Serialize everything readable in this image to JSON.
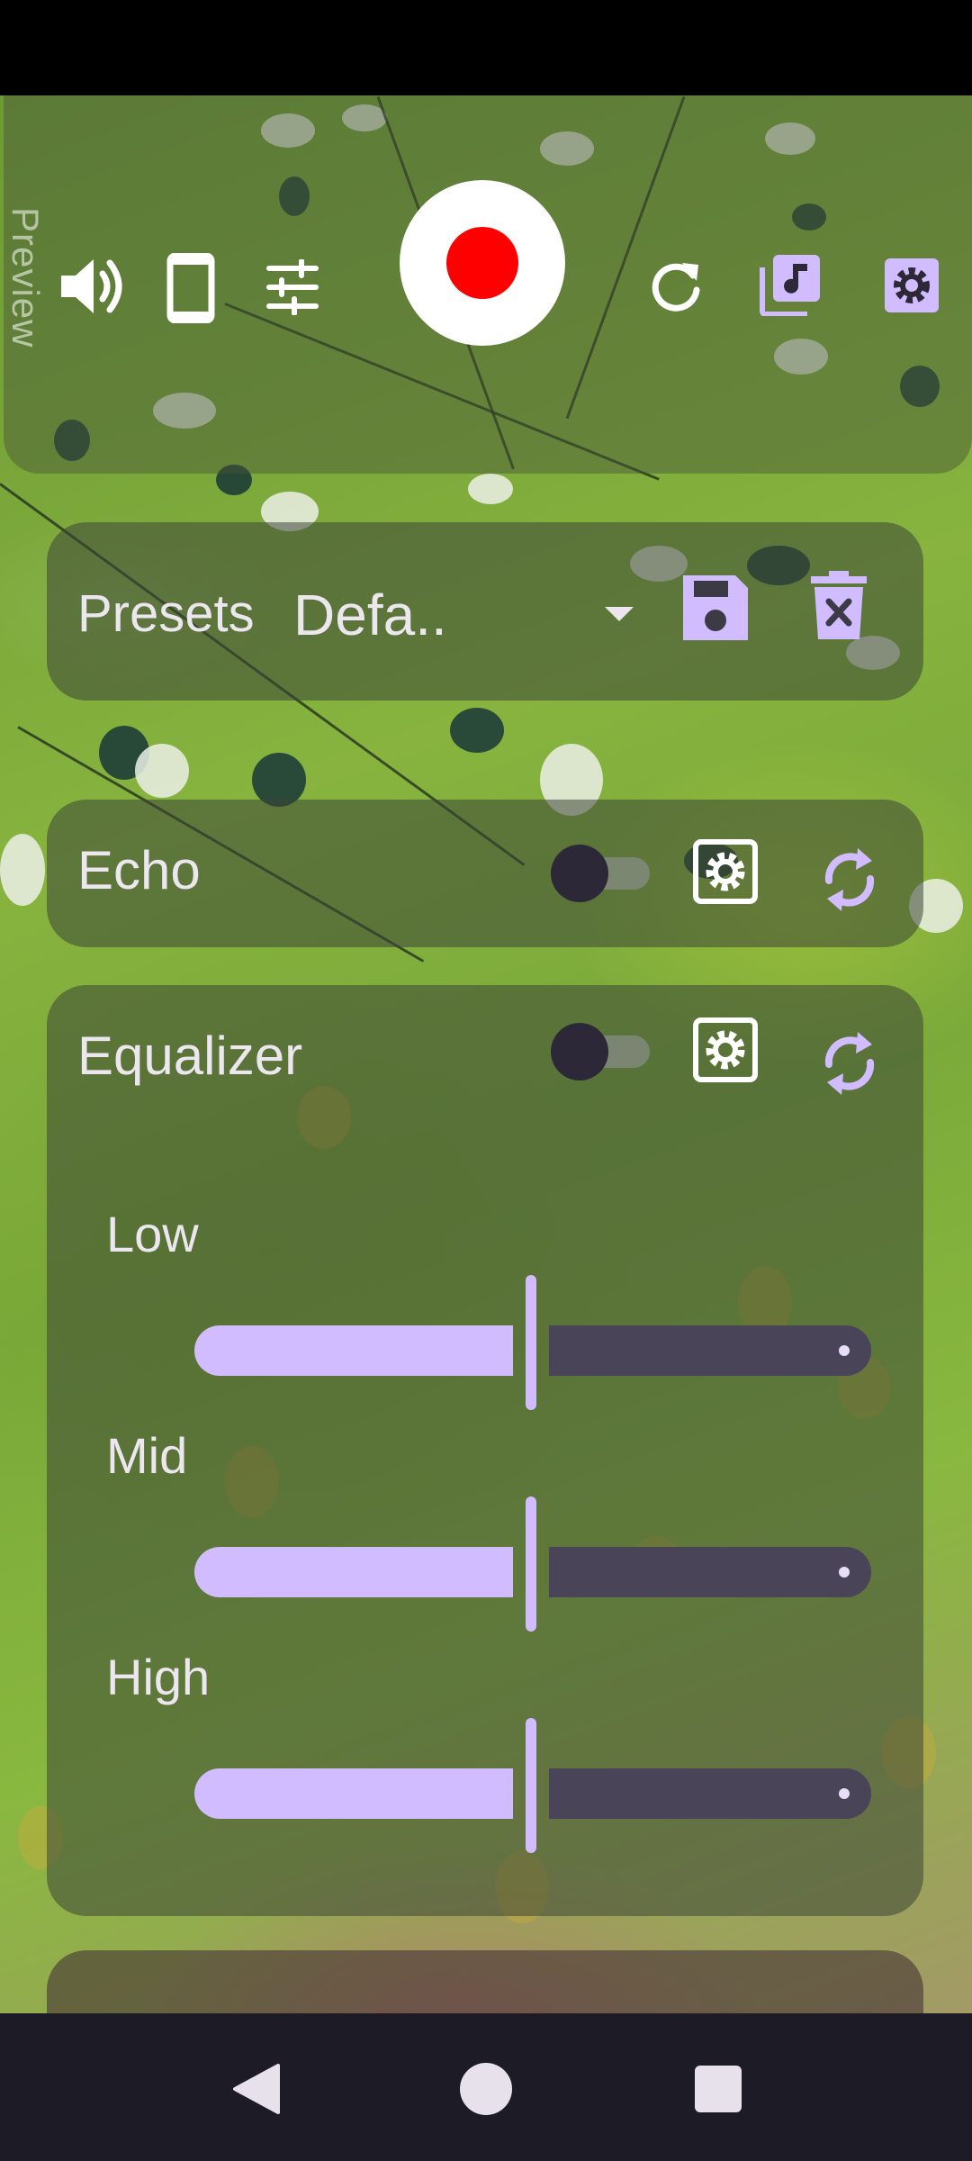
{
  "top_panel": {
    "preview_label": "Preview",
    "icons": [
      "speaker-icon",
      "phone-icon",
      "sliders-icon",
      "record-icon",
      "refresh-icon",
      "music-library-icon",
      "settings-icon"
    ]
  },
  "presets": {
    "label": "Presets",
    "selected": "Defa.."
  },
  "echo": {
    "title": "Echo",
    "enabled": false
  },
  "equalizer": {
    "title": "Equalizer",
    "enabled": false,
    "bands": [
      {
        "label": "Low",
        "value": 0.5
      },
      {
        "label": "Mid",
        "value": 0.5
      },
      {
        "label": "High",
        "value": 0.5
      }
    ]
  },
  "colors": {
    "accent": "#d0bcff",
    "record": "#ff0000",
    "track": "#4a4458"
  }
}
